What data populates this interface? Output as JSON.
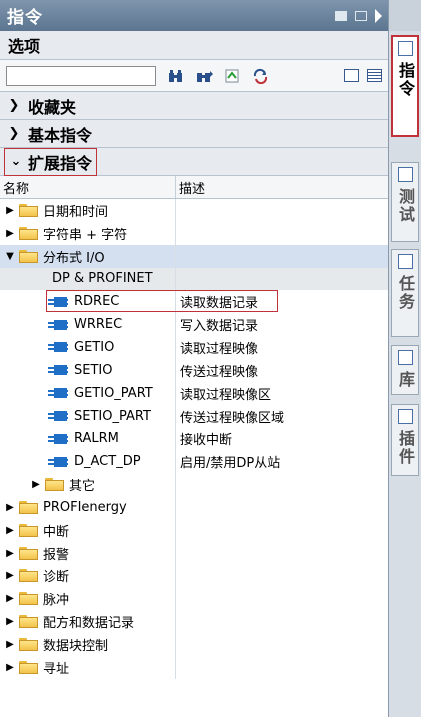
{
  "panel": {
    "title": "指令",
    "options_label": "选项",
    "sections": {
      "favorites": "收藏夹",
      "basic": "基本指令",
      "extended": "扩展指令"
    },
    "columns": [
      "名称",
      "描述"
    ],
    "toolbar_icons": [
      "find-icon",
      "find-next-icon",
      "filter-icon",
      "refresh-icon",
      "view-icon",
      "list-view-icon"
    ],
    "tree": [
      {
        "type": "folder",
        "level": 0,
        "state": "collapsed",
        "name": "日期和时间",
        "desc": ""
      },
      {
        "type": "folder",
        "level": 0,
        "state": "collapsed",
        "name": "字符串 + 字符",
        "desc": ""
      },
      {
        "type": "folder",
        "level": 0,
        "state": "expanded",
        "name": "分布式 I/O",
        "desc": "",
        "selected": true
      },
      {
        "type": "group",
        "level": 1,
        "name": "DP & PROFINET",
        "desc": ""
      },
      {
        "type": "block",
        "level": 1,
        "name": "RDREC",
        "desc": "读取数据记录",
        "highlight": true
      },
      {
        "type": "block",
        "level": 1,
        "name": "WRREC",
        "desc": "写入数据记录"
      },
      {
        "type": "block",
        "level": 1,
        "name": "GETIO",
        "desc": "读取过程映像"
      },
      {
        "type": "block",
        "level": 1,
        "name": "SETIO",
        "desc": "传送过程映像"
      },
      {
        "type": "block",
        "level": 1,
        "name": "GETIO_PART",
        "desc": "读取过程映像区"
      },
      {
        "type": "block",
        "level": 1,
        "name": "SETIO_PART",
        "desc": "传送过程映像区域"
      },
      {
        "type": "block",
        "level": 1,
        "name": "RALRM",
        "desc": "接收中断"
      },
      {
        "type": "block",
        "level": 1,
        "name": "D_ACT_DP",
        "desc": "启用/禁用DP从站"
      },
      {
        "type": "folder",
        "level": 1,
        "state": "collapsed",
        "name": "其它",
        "desc": ""
      },
      {
        "type": "folder",
        "level": 0,
        "state": "collapsed",
        "name": "PROFIenergy",
        "desc": ""
      },
      {
        "type": "folder",
        "level": 0,
        "state": "collapsed",
        "name": "中断",
        "desc": ""
      },
      {
        "type": "folder",
        "level": 0,
        "state": "collapsed",
        "name": "报警",
        "desc": ""
      },
      {
        "type": "folder",
        "level": 0,
        "state": "collapsed",
        "name": "诊断",
        "desc": ""
      },
      {
        "type": "folder",
        "level": 0,
        "state": "collapsed",
        "name": "脉冲",
        "desc": ""
      },
      {
        "type": "folder",
        "level": 0,
        "state": "collapsed",
        "name": "配方和数据记录",
        "desc": ""
      },
      {
        "type": "folder",
        "level": 0,
        "state": "collapsed",
        "name": "数据块控制",
        "desc": ""
      },
      {
        "type": "folder",
        "level": 0,
        "state": "collapsed",
        "name": "寻址",
        "desc": ""
      }
    ]
  },
  "side_tabs": [
    {
      "label": "指令",
      "active": true
    },
    {
      "label": "测试",
      "active": false
    },
    {
      "label": "任务",
      "active": false
    },
    {
      "label": "库",
      "active": false
    },
    {
      "label": "插件",
      "active": false
    }
  ],
  "colors": {
    "accent_red": "#c0323a",
    "title_bar": "#6a829c",
    "selection": "#d4dff0",
    "block_blue": "#1f6fc6"
  }
}
